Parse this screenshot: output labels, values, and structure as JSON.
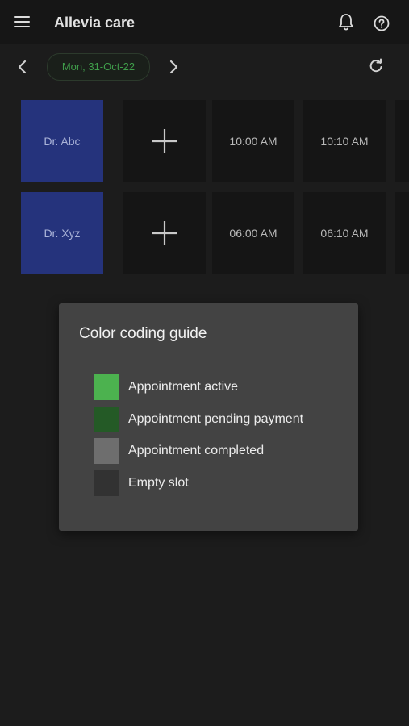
{
  "app": {
    "title": "Allevia care"
  },
  "icons": {
    "menu": "hamburger-menu-icon",
    "notifications": "bell-icon",
    "help": "help-circle-icon",
    "previous": "chevron-left-icon",
    "next": "chevron-right-icon",
    "refresh": "refresh-icon",
    "add": "plus-icon"
  },
  "date_bar": {
    "date": "Mon, 31-Oct-22"
  },
  "schedule": {
    "rows": [
      {
        "doctor": "Dr. Abc",
        "slots": [
          "10:00 AM",
          "10:10 AM"
        ]
      },
      {
        "doctor": "Dr. Xyz",
        "slots": [
          "06:00 AM",
          "06:10 AM"
        ]
      }
    ]
  },
  "guide": {
    "title": "Color coding guide",
    "items": [
      {
        "label": "Appointment active",
        "color": "#4cb24f"
      },
      {
        "label": "Appointment pending payment",
        "color": "#245a26"
      },
      {
        "label": "Appointment completed",
        "color": "#6e6e6e"
      },
      {
        "label": "Empty slot",
        "color": "#323232"
      }
    ]
  },
  "colors": {
    "doctor_tile": "#25337c",
    "date_text": "#3f9d4a",
    "background": "#1c1c1c"
  }
}
